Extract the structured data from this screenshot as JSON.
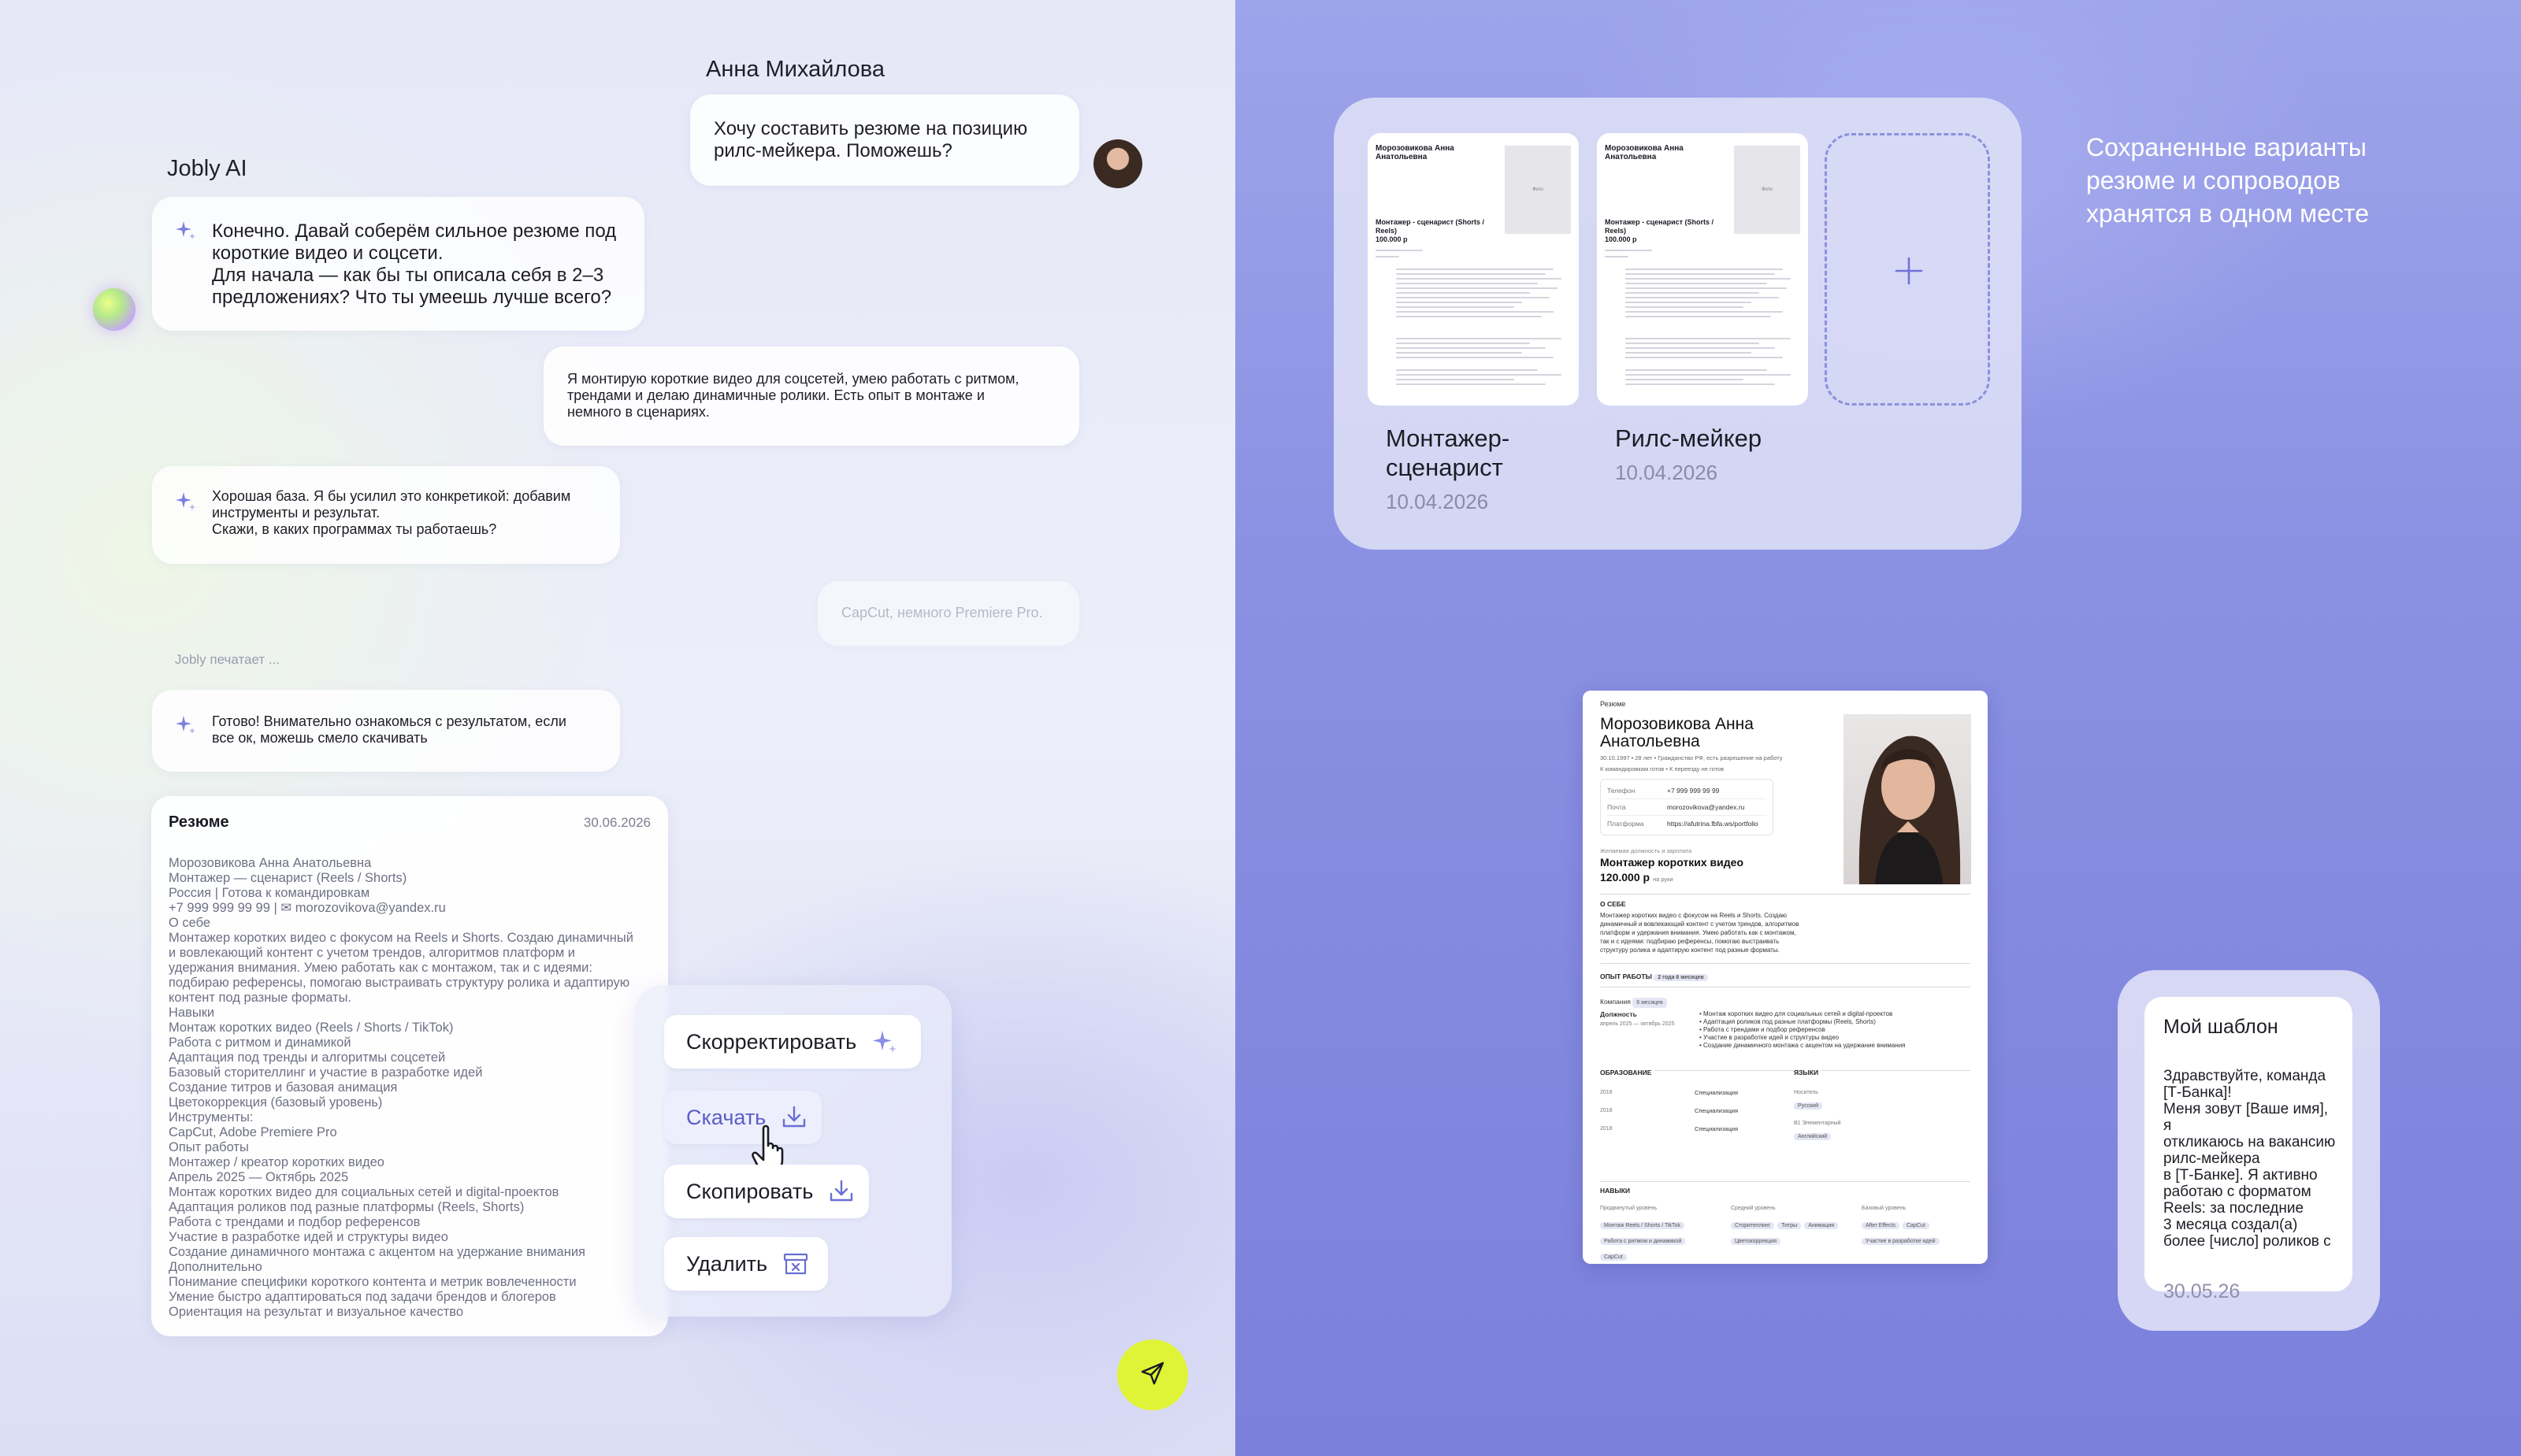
{
  "chat": {
    "user_name": "Анна Михайлова",
    "ai_name": "Jobly AI",
    "messages": [
      {
        "from": "user",
        "text": "Хочу составить резюме на позицию\nрилс-мейкера. Поможешь?"
      },
      {
        "from": "ai",
        "text": "Конечно. Давай соберём сильное резюме под\nкороткие видео и соцсети.\nДля начала — как бы ты описала себя в 2–3\nпредложениях? Что ты умеешь лучше всего?"
      },
      {
        "from": "user",
        "text": "Я монтирую короткие видео для соцсетей, умею работать с ритмом,\nтрендами и делаю динамичные ролики. Есть опыт в монтаже и\nнемного в сценариях."
      },
      {
        "from": "ai",
        "text": "Хорошая база. Я бы усилил это конкретикой: добавим\nинструменты и результат.\nСкажи, в каких программах ты работаешь?"
      },
      {
        "from": "user",
        "text": "CapCut, немного Premiere Pro."
      },
      {
        "from": "ai",
        "text": "Готово! Внимательно ознакомься с результатом, если\nвсе ок, можешь смело скачивать"
      }
    ],
    "typing": "Jobly печатает ..."
  },
  "resume_card": {
    "title": "Резюме",
    "date": "30.06.2026",
    "lines": [
      "Морозовикова Анна Анатольевна",
      "Монтажер — сценарист (Reels / Shorts)",
      "Россия | Готова к командировкам",
      "+7 999 999 99 99 | ✉ morozovikova@yandex.ru",
      "О себе",
      "Монтажер коротких видео с фокусом на Reels и Shorts. Создаю динамичный",
      "и вовлекающий контент с учетом трендов, алгоритмов платформ и",
      "удержания внимания. Умею работать как с монтажом, так и с идеями:",
      "подбираю референсы, помогаю выстраивать структуру ролика и адаптирую",
      "контент под разные форматы.",
      "Навыки",
      "Монтаж коротких видео (Reels / Shorts / TikTok)",
      "Работа с ритмом и динамикой",
      "Адаптация под тренды и алгоритмы соцсетей",
      "Базовый сторителлинг и участие в разработке идей",
      "Создание титров и базовая анимация",
      "Цветокоррекция (базовый уровень)",
      "Инструменты:",
      "CapCut, Adobe Premiere Pro",
      "Опыт работы",
      "Монтажер / креатор коротких видео",
      "Апрель 2025 — Октябрь 2025",
      "Монтаж коротких видео для социальных сетей и digital-проектов",
      "Адаптация роликов под разные платформы (Reels, Shorts)",
      "Работа с трендами и подбор референсов",
      "Участие в разработке идей и структуры видео",
      "Создание динамичного монтажа с акцентом на удержание внимания",
      "Дополнительно",
      "Понимание специфики короткого контента и метрик вовлеченности",
      "Умение быстро адаптироваться под задачи брендов и блогеров",
      "Ориентация на результат и визуальное качество"
    ]
  },
  "actions": {
    "correct": "Скорректировать",
    "download": "Скачать",
    "copy": "Скопировать",
    "delete": "Удалить"
  },
  "saved": {
    "caption": "Сохраненные варианты\nрезюме и сопроводов\nхранятся в одном месте",
    "items": [
      {
        "label": "Монтажер-\nсценарист",
        "date": "10.04.2026",
        "thumb_name": "Морозовикова Анна Анатольевна",
        "thumb_title": "Монтажер - сценарист (Shorts / Reels)",
        "thumb_salary": "100.000 р",
        "photo_label": "Фото"
      },
      {
        "label": "Рилс-мейкер",
        "date": "10.04.2026",
        "thumb_name": "Морозовикова Анна Анатольевна",
        "thumb_title": "Монтажер - сценарист (Shorts / Reels)",
        "thumb_salary": "100.000 р",
        "photo_label": "Фото"
      }
    ]
  },
  "preview": {
    "label": "Резюме",
    "name": "Морозовикова Анна\nАнатольевна",
    "meta": "30.10.1997  •  28 лет  •  Гражданство РФ, есть разрешение на работу",
    "meta2": "К командировкам готов  •  К переезду не готов",
    "contacts": [
      {
        "k": "Телефон",
        "v": "+7 999 999 99 99"
      },
      {
        "k": "Почта",
        "v": "morozovikova@yandex.ru"
      },
      {
        "k": "Платформа",
        "v": "https://afutrina.fbfa.ws/portfolio"
      }
    ],
    "desired_label": "Желаемая должность и зарплата",
    "position": "Монтажер коротких видео",
    "salary": "120.000 р",
    "salary_note": "на руки",
    "about_h": "О СЕБЕ",
    "about": "Монтажер коротких видео с фокусом на Reels и Shorts. Создаю\nдинамичный и вовлекающий контент с учетом трендов, алгоритмов\nплатформ и удержания внимания. Умею работать как с монтажом,\nтак и с идеями: подбираю референсы, помогаю выстраивать\nструктуру ролика и адаптирую контент под разные форматы.",
    "exp_h": "ОПЫТ РАБОТЫ",
    "exp_tag": "2 года 6 месяцев",
    "company": "Компания",
    "company_tag": "6 месяцев",
    "role": "Должность",
    "period": "апрель 2025 — октябрь 2025",
    "duties": [
      "Монтаж коротких видео для социальных сетей и digital-проектов",
      "Адаптация роликов под разные платформы (Reels, Shorts)",
      "Работа с трендами и подбор референсов",
      "Участие в разработке идей и структуры видео",
      "Создание динамичного монтажа с акцентом на удержание внимания"
    ],
    "edu_h": "ОБРАЗОВАНИЕ",
    "lang_h": "ЯЗЫКИ",
    "edu": [
      {
        "year": "2016",
        "sub": "Бакалавр",
        "name": "Учебное заведение",
        "spec": "Специализация"
      },
      {
        "year": "2018",
        "sub": "Магистр",
        "name": "Учебное заведение",
        "spec": "Специализация"
      },
      {
        "year": "2018",
        "sub": "Курсы",
        "name": "Учебное заведение",
        "spec": "Специализация"
      }
    ],
    "langs": [
      {
        "level": "Носитель",
        "tag": "Русский"
      },
      {
        "level": "B1 Элементарный",
        "tag": "Английский"
      }
    ],
    "skills_h": "НАВЫКИ",
    "skill_groups": [
      {
        "title": "Продвинутый уровень",
        "tags": [
          "Монтаж Reels / Shorts / TikTok",
          "Работа с ритмом и динамикой",
          "CapCut"
        ]
      },
      {
        "title": "Средний уровень",
        "tags": [
          "Сторителлинг",
          "Титры",
          "Анимация",
          "Цветокоррекция"
        ]
      },
      {
        "title": "Базовый уровень",
        "tags": [
          "After Effects",
          "CapCut",
          "Участие в разработке идей"
        ]
      }
    ]
  },
  "template": {
    "title": "Мой шаблон",
    "body": "Здравствуйте, команда\n[Т-Банка]!\nМеня зовут [Ваше имя], я\nоткликаюсь на вакансию\nрилс-мейкера\nв [Т-Банке]. Я активно\nработаю с форматом\nReels: за последние\n3 месяца создал(а)\nболее [число] роликов с",
    "date": "30.05.26"
  },
  "colors": {
    "accent": "#6f73d8",
    "send_button": "#dff436",
    "right_bg": "#8a90e2"
  }
}
